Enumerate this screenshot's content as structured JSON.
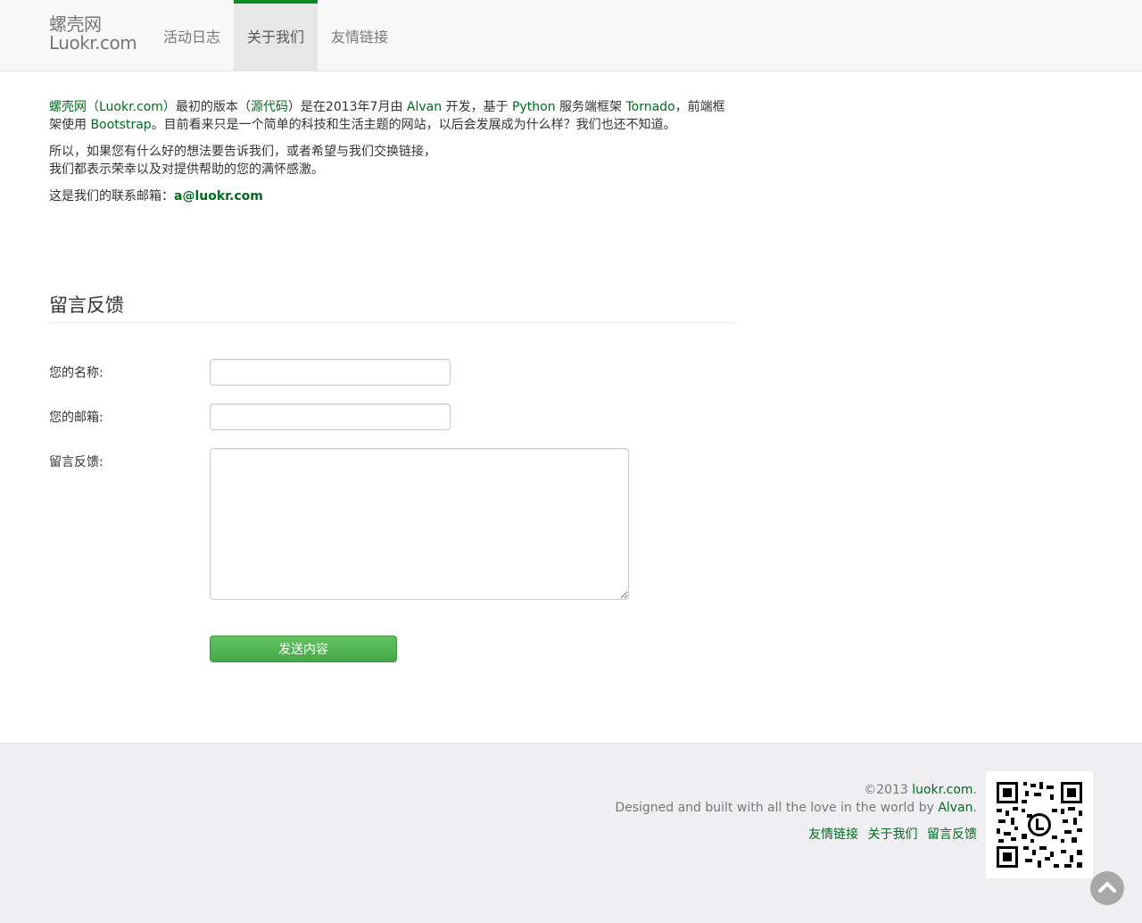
{
  "brand": {
    "line1": "螺壳网",
    "line2": "Luokr.com"
  },
  "nav": [
    {
      "label": "活动日志"
    },
    {
      "label": "关于我们",
      "active": true
    },
    {
      "label": "友情链接"
    }
  ],
  "about": {
    "p1": {
      "site": "螺壳网（Luokr.com）",
      "t1": "最初的版本（",
      "source": "源代码",
      "t2": "）是在2013年7月由 ",
      "author": "Alvan",
      "t3": " 开发，基于 ",
      "python": "Python",
      "t4": " 服务端框架 ",
      "tornado": "Tornado",
      "t5": "，前端框架使用 ",
      "bootstrap": "Bootstrap",
      "t6": "。目前看来只是一个简单的科技和生活主题的网站，以后会发展成为什么样？我们也还不知道。"
    },
    "p2_line1": "所以，如果您有什么好的想法要告诉我们，或者希望与我们交换链接，",
    "p2_line2": "我们都表示荣幸以及对提供帮助的您的满怀感激。",
    "p3_label": "这是我们的联系邮箱：",
    "p3_email": "a@luokr.com"
  },
  "feedback": {
    "title": "留言反馈",
    "name_label": "您的名称:",
    "email_label": "您的邮箱:",
    "message_label": "留言反馈:",
    "name_value": "",
    "email_value": "",
    "message_value": "",
    "submit_label": "发送内容"
  },
  "footer": {
    "copyright_prefix": "©2013 ",
    "copyright_site": "luokr.com",
    "copyright_suffix": ".",
    "credit_prefix": "Designed and built with all the love in the world by ",
    "credit_author": "Alvan",
    "credit_suffix": ".",
    "links": [
      "友情链接",
      "关于我们",
      "留言反馈"
    ]
  },
  "icons": {
    "qr": "qr-code-icon",
    "top": "chevron-up-icon"
  },
  "colors": {
    "link": "#006b1e",
    "nav_active_border": "#0a8a22",
    "button": "#4fb54f"
  }
}
